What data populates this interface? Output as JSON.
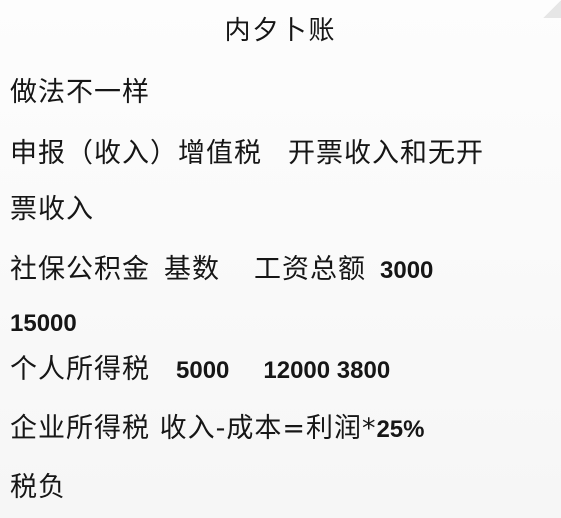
{
  "title": "内夕卜账",
  "lines": {
    "l1": "做法不一样",
    "l2a": "申报（收入）增值税",
    "l2b": "开票收入和无开",
    "l3": "票收入",
    "l4a": "社保公积金",
    "l4b": "基数",
    "l4c": "工资总额",
    "l4d": "3000",
    "l5": "15000",
    "l6a": "个人所得税",
    "l6b": "5000",
    "l6c": "12000 3800",
    "l7a": "企业所得税 收入-成本=利润*",
    "l7b": "25%",
    "l8": "税负"
  }
}
